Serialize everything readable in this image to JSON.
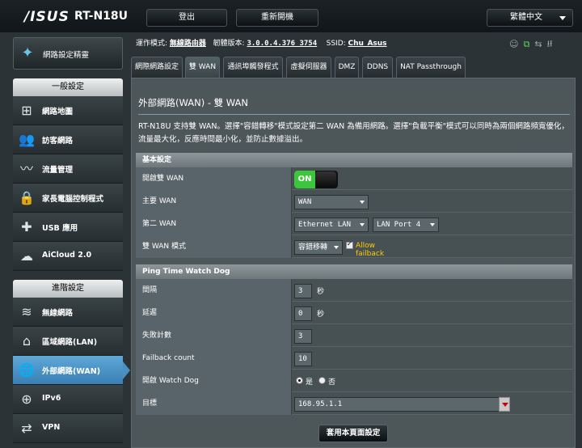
{
  "brand": {
    "logo": "/ISUS",
    "model": "RT-N18U"
  },
  "header": {
    "logout": "登出",
    "reboot": "重新開機",
    "language": "繁體中文"
  },
  "info": {
    "mode_label": "運作模式:",
    "mode_value": "無線路由器",
    "fw_label": "韌體版本:",
    "fw_value": "3.0.0.4.376_3754",
    "ssid_label": "SSID:",
    "ssid_value": "Chu_Asus"
  },
  "sidebar": {
    "qis": "網路設定精靈",
    "general_header": "一般設定",
    "general": [
      {
        "label": "網路地圖",
        "icon": "network-map-icon"
      },
      {
        "label": "訪客網路",
        "icon": "guest-network-icon"
      },
      {
        "label": "流量管理",
        "icon": "traffic-manager-icon"
      },
      {
        "label": "家長電腦控制程式",
        "icon": "parental-control-icon"
      },
      {
        "label": "USB 應用",
        "icon": "usb-app-icon"
      },
      {
        "label": "AiCloud 2.0",
        "icon": "aicloud-icon"
      }
    ],
    "advanced_header": "進階設定",
    "advanced": [
      {
        "label": "無線網路",
        "icon": "wireless-icon"
      },
      {
        "label": "區域網路(LAN)",
        "icon": "lan-icon"
      },
      {
        "label": "外部網路(WAN)",
        "icon": "wan-icon"
      },
      {
        "label": "IPv6",
        "icon": "ipv6-icon"
      },
      {
        "label": "VPN",
        "icon": "vpn-icon"
      }
    ]
  },
  "tabs": [
    {
      "label": "網際網路設定"
    },
    {
      "label": "雙 WAN"
    },
    {
      "label": "通訊埠觸發程式"
    },
    {
      "label": "虛擬伺服器"
    },
    {
      "label": "DMZ"
    },
    {
      "label": "DDNS"
    },
    {
      "label": "NAT Passthrough"
    }
  ],
  "page": {
    "title": "外部網路(WAN) - 雙 WAN",
    "description": "RT-N18U 支持雙 WAN。選擇\"容錯轉移\"模式設定第二 WAN 為備用網路。選擇\"負載平衡\"模式可以同時為兩個網路頻寬優化，流量最大化，反應時間最小化，並防止數據溢出。"
  },
  "basic": {
    "header": "基本設定",
    "enable_label": "開啟雙 WAN",
    "enable_value": "ON",
    "primary_label": "主要 WAN",
    "primary_value": "WAN",
    "secondary_label": "第二 WAN",
    "secondary_value": "Ethernet LAN",
    "secondary_port": "LAN Port 4",
    "mode_label": "雙 WAN 模式",
    "mode_value": "容錯移轉",
    "allow_failback": "Allow failback"
  },
  "ping": {
    "header": "Ping Time Watch Dog",
    "interval_label": "間隔",
    "interval_value": "3",
    "interval_unit": "秒",
    "delay_label": "延遲",
    "delay_value": "0",
    "delay_unit": "秒",
    "fail_label": "失敗計數",
    "fail_value": "3",
    "failback_label": "Failback count",
    "failback_value": "10",
    "watchdog_label": "開啟 Watch Dog",
    "yes": "是",
    "no": "否",
    "target_label": "目標",
    "target_value": "168.95.1.1"
  },
  "apply": "套用本頁面設定"
}
